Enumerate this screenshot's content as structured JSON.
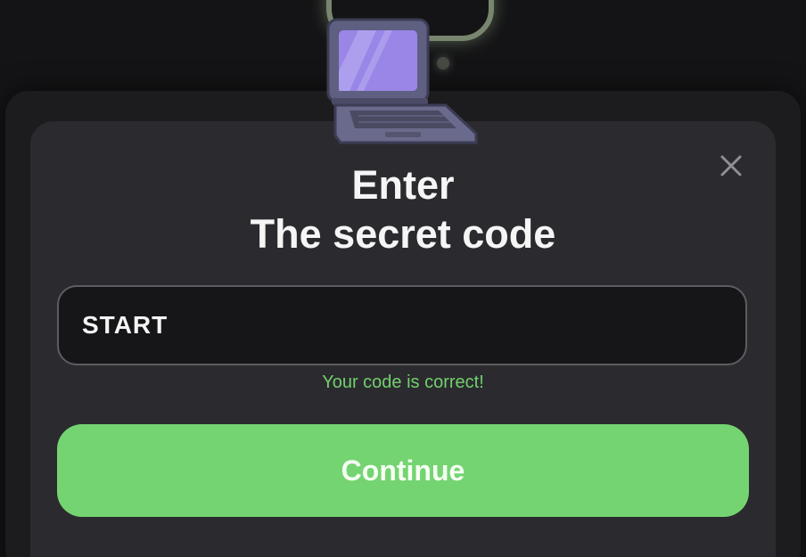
{
  "dialog": {
    "title_line1": "Enter",
    "title_line2": "The secret code",
    "close_icon": "close-icon"
  },
  "code_field": {
    "value": "START",
    "placeholder": ""
  },
  "status": {
    "message": "Your code is correct!",
    "state": "success"
  },
  "actions": {
    "continue_label": "Continue"
  },
  "illustration": {
    "icon": "laptop-icon"
  },
  "colors": {
    "accent": "#74d471",
    "success_text": "#72cf6d",
    "modal_bg": "#2b2b2f",
    "page_bg": "#141416",
    "screen": "#9a86e6"
  }
}
